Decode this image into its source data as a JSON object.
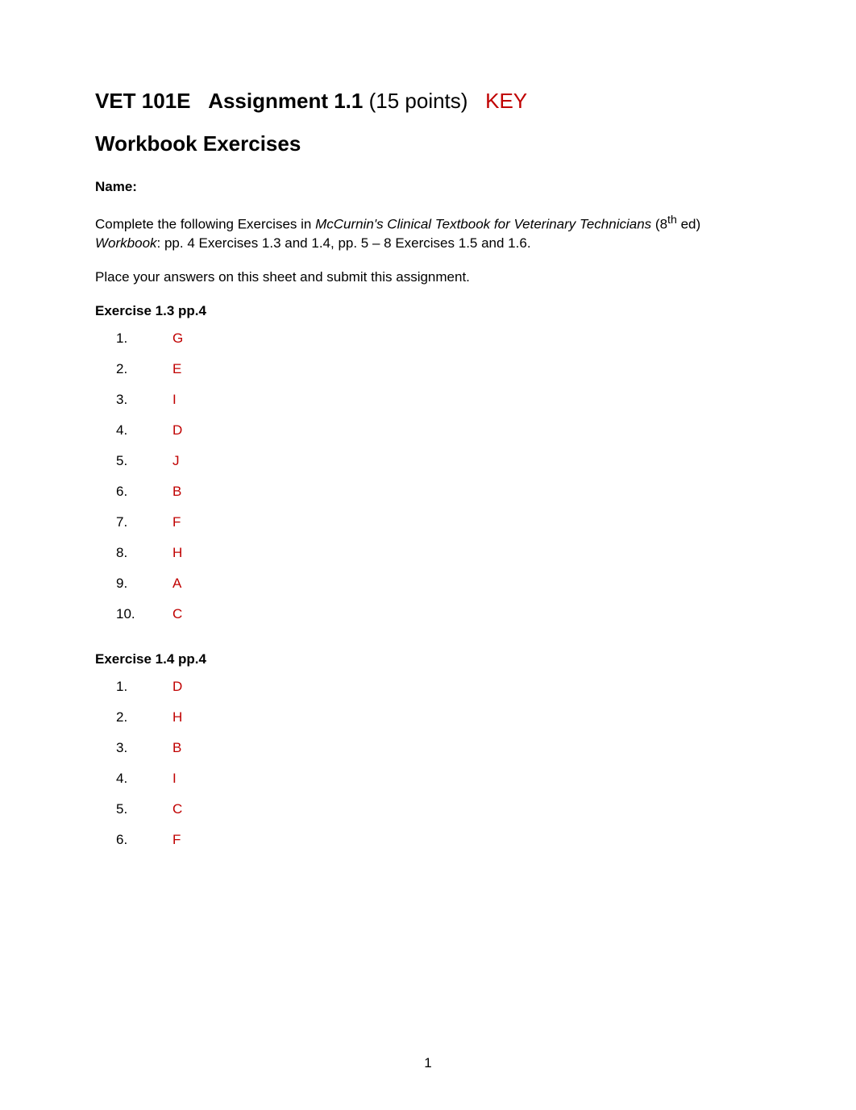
{
  "header": {
    "course": "VET 101E",
    "assignment": "Assignment 1.1",
    "points": "(15 points)",
    "key": "KEY"
  },
  "subtitle": "Workbook Exercises",
  "nameLabel": "Name:",
  "instructions1_a": "Complete the following Exercises in ",
  "instructions1_b": "McCurnin's  Clinical Textbook for Veterinary Technicians",
  "instructions1_c": " (8",
  "instructions1_d": "th",
  "instructions1_e": " ed) ",
  "instructions1_f": "Workbook",
  "instructions1_g": ":   pp. 4  Exercises 1.3 and 1.4, pp. 5 – 8 Exercises 1.5 and 1.6.",
  "instructions2": "Place your answers on this sheet and submit this assignment.",
  "exercise13": {
    "heading": "Exercise 1.3  pp.4",
    "items": [
      {
        "n": "1.",
        "v": "G"
      },
      {
        "n": "2.",
        "v": "E"
      },
      {
        "n": "3.",
        "v": "I"
      },
      {
        "n": "4.",
        "v": "D"
      },
      {
        "n": "5.",
        "v": "J"
      },
      {
        "n": "6.",
        "v": "B"
      },
      {
        "n": "7.",
        "v": "F"
      },
      {
        "n": "8.",
        "v": "H"
      },
      {
        "n": "9.",
        "v": "A"
      },
      {
        "n": "10.",
        "v": "C"
      }
    ]
  },
  "exercise14": {
    "heading": "Exercise 1.4  pp.4",
    "items": [
      {
        "n": "1.",
        "v": "D"
      },
      {
        "n": "2.",
        "v": "H"
      },
      {
        "n": "3.",
        "v": "B"
      },
      {
        "n": "4.",
        "v": "I"
      },
      {
        "n": "5.",
        "v": "C"
      },
      {
        "n": "6.",
        "v": "F"
      }
    ]
  },
  "pageNumber": "1"
}
